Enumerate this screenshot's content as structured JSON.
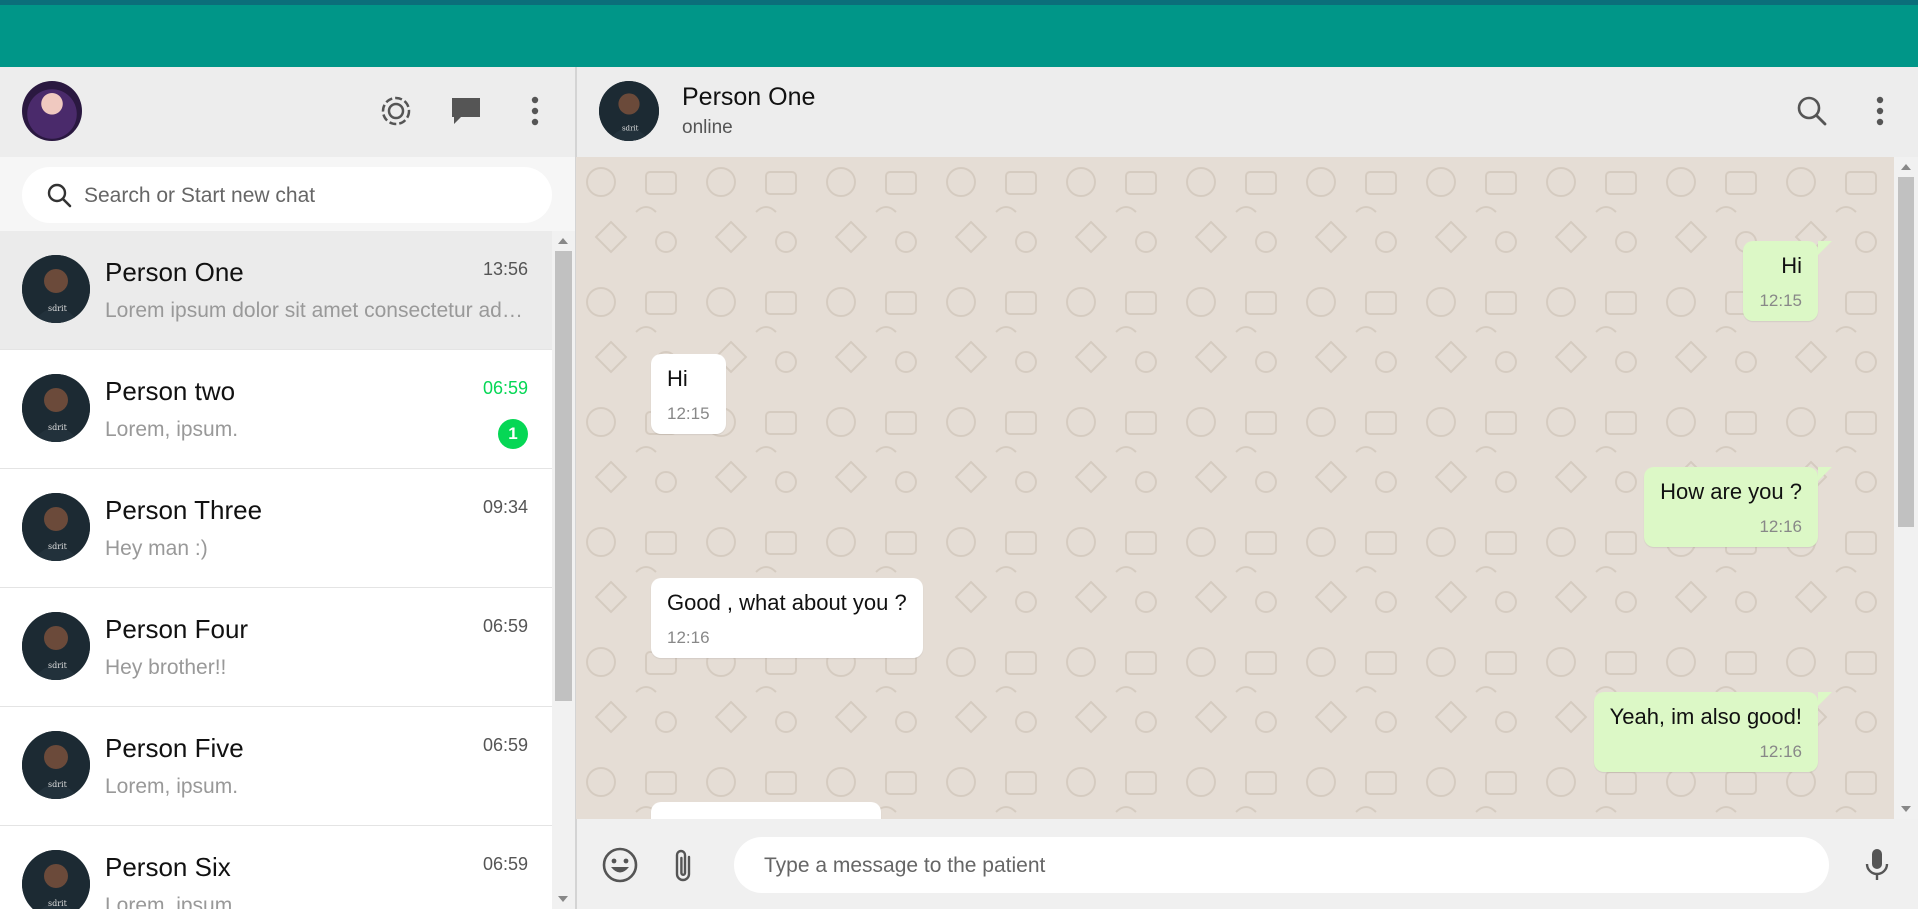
{
  "sidebar": {
    "search": {
      "placeholder": "Search or Start new chat",
      "value": ""
    },
    "header_icons": [
      "status-icon",
      "new-chat-icon",
      "menu-icon"
    ],
    "chats": [
      {
        "name": "Person One",
        "time": "13:56",
        "preview": "Lorem ipsum dolor sit amet consectetur adipisicing elit.",
        "unread": "",
        "active": true
      },
      {
        "name": "Person two",
        "time": "06:59",
        "preview": "Lorem, ipsum.",
        "unread": "1",
        "active": false
      },
      {
        "name": "Person Three",
        "time": "09:34",
        "preview": "Hey man :)",
        "unread": "",
        "active": false
      },
      {
        "name": "Person Four",
        "time": "06:59",
        "preview": "Hey brother!!",
        "unread": "",
        "active": false
      },
      {
        "name": "Person Five",
        "time": "06:59",
        "preview": "Lorem, ipsum.",
        "unread": "",
        "active": false
      },
      {
        "name": "Person Six",
        "time": "06:59",
        "preview": "Lorem, ipsum.",
        "unread": "",
        "active": false
      }
    ]
  },
  "conversation": {
    "contact_name": "Person One",
    "contact_status": "online",
    "messages": [
      {
        "direction": "out",
        "text": "Hi",
        "time": "12:15"
      },
      {
        "direction": "in",
        "text": "Hi",
        "time": "12:15"
      },
      {
        "direction": "out",
        "text": "How are you ?",
        "time": "12:16"
      },
      {
        "direction": "in",
        "text": "Good , what about you ?",
        "time": "12:16"
      },
      {
        "direction": "out",
        "text": "Yeah, im also good!",
        "time": "12:16"
      }
    ]
  },
  "composer": {
    "placeholder": "Type a message to the patient",
    "value": ""
  },
  "colors": {
    "brand": "#009688",
    "outgoing_bubble": "#dcf8c6",
    "unread": "#06d755",
    "header_bg": "#ededed"
  }
}
